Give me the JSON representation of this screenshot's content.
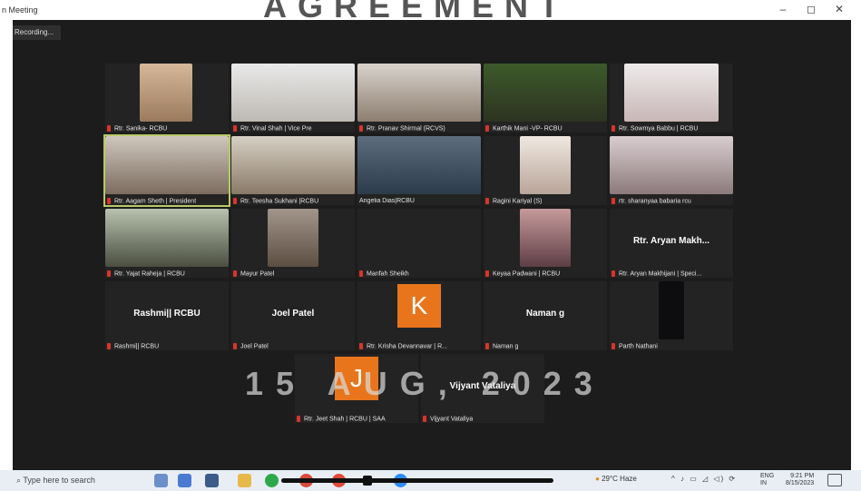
{
  "window": {
    "title": "n Meeting",
    "controls": [
      "–",
      "◻",
      "✕"
    ]
  },
  "meeting": {
    "recording_label": "Recording...",
    "watermark_top": "AGREEMENT",
    "watermark_date": "15 AUG, 2023",
    "rows": [
      [
        {
          "label": "Rtr. Sanika- RCBU",
          "kind": "video"
        },
        {
          "label": "Rtr. Vinal Shah | Vice Pre",
          "kind": "video"
        },
        {
          "label": "Rtr. Pranav Shirmal (RCVS)",
          "kind": "video"
        },
        {
          "label": "Karthik Mani -VP- RCBU",
          "kind": "video"
        },
        {
          "label": "Rtr. Sowmya Babbu | RCBU",
          "kind": "video"
        }
      ],
      [
        {
          "label": "Rtr. Aagam Sheth | President",
          "kind": "video",
          "active": true
        },
        {
          "label": "Rtr. Teesha Sukhani |RCBU",
          "kind": "video"
        },
        {
          "label": "Angelia Dias|RCBU",
          "kind": "video"
        },
        {
          "label": "Ragini Kariyal (S)",
          "kind": "video"
        },
        {
          "label": "rtr. sharanyaa babaria rcu",
          "kind": "video"
        }
      ],
      [
        {
          "label": "Rtr. Yajat Raheja | RCBU",
          "kind": "video"
        },
        {
          "label": "Mayur Patel",
          "kind": "video"
        },
        {
          "label": "Manfah Sheikh",
          "kind": "blank"
        },
        {
          "label": "Keyaa Padwani | RCBU",
          "kind": "video"
        },
        {
          "label": "Rtr. Aryan Makhijani | Speci...",
          "kind": "name",
          "name": "Rtr. Aryan Makh..."
        }
      ],
      [
        {
          "label": "Rashmi|| RCBU",
          "kind": "name",
          "name": "Rashmi|| RCBU"
        },
        {
          "label": "Joel Patel",
          "kind": "name",
          "name": "Joel Patel"
        },
        {
          "label": "Rtr. Krisha Devannavar | R...",
          "kind": "avatar",
          "initial": "K"
        },
        {
          "label": "Naman g",
          "kind": "name",
          "name": "Naman g"
        },
        {
          "label": "Parth Nathani",
          "kind": "darkvideo"
        }
      ],
      [
        {
          "label": "Rtr. Jeet Shah | RCBU | SAA",
          "kind": "avatar",
          "initial": "J"
        },
        {
          "label": "Vijyant Vataliya",
          "kind": "name",
          "name": "Vijyant Vataliya"
        }
      ]
    ]
  },
  "taskbar": {
    "search_placeholder": "Type here to search",
    "weather": "29°C  Haze",
    "tray": "^ ♪ ▭ ◿ ◁) ⟳",
    "lang": "ENG",
    "lang_region": "IN",
    "time": "9:21 PM",
    "date": "8/15/2023"
  },
  "colors": {
    "meeting_bg": "#1c1c1c",
    "tile_bg": "#232323",
    "avatar_orange": "#e8751c",
    "mic_red": "#d9342b",
    "active_border": "#b7c96a"
  }
}
